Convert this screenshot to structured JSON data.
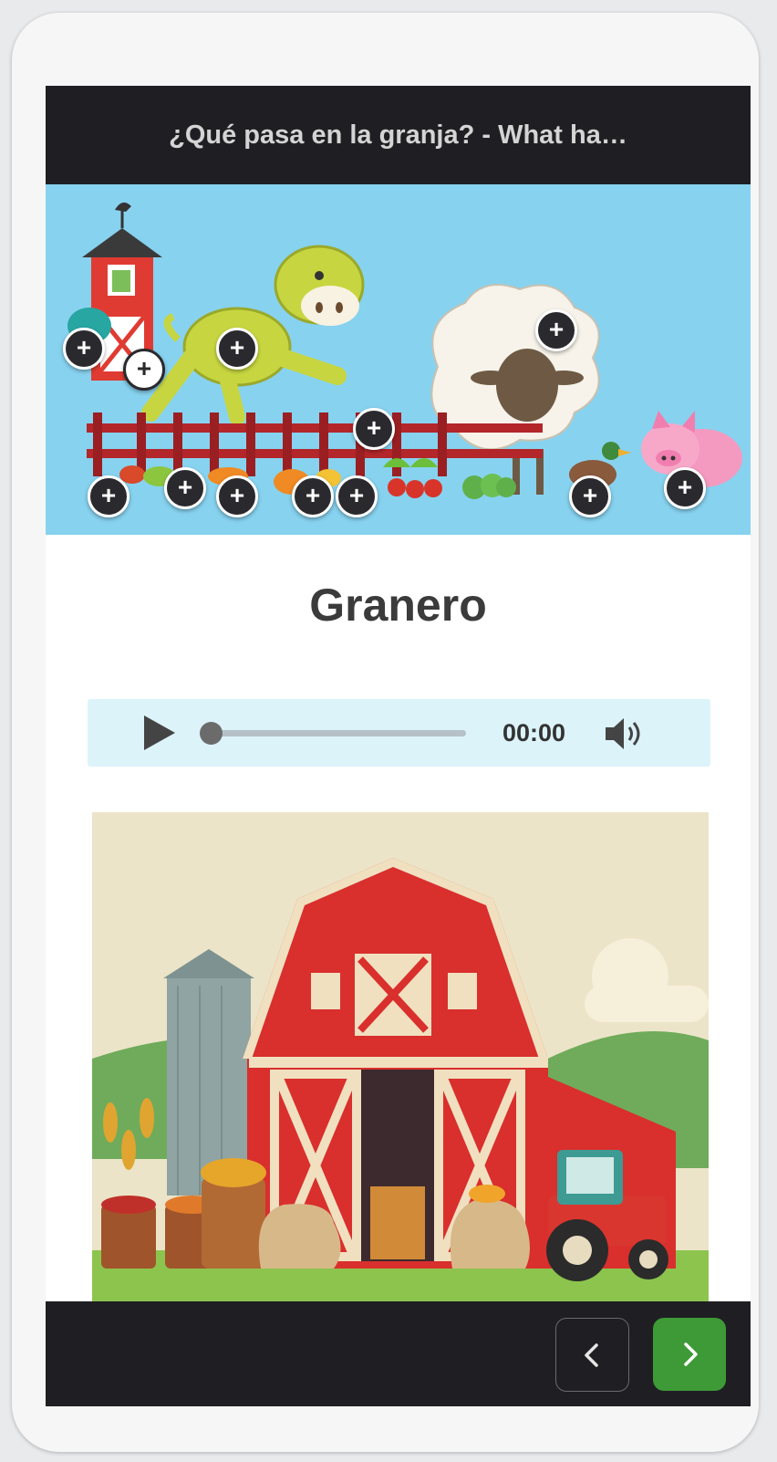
{
  "header": {
    "title": "¿Qué pasa en la granja? - What ha…"
  },
  "scene": {
    "hotspot_label": "+",
    "hotspots": [
      "+",
      "+",
      "+",
      "+",
      "+",
      "+",
      "+",
      "+",
      "+",
      "+",
      "+",
      "+",
      "+",
      "+"
    ]
  },
  "page": {
    "title": "Granero"
  },
  "audio": {
    "time": "00:00",
    "progress": 0
  },
  "picture": {
    "subject": "red barn with silo, tractor and grain sacks"
  },
  "nav": {
    "prev": "chevron-left-icon",
    "next": "chevron-right-icon"
  },
  "colors": {
    "header_bg": "#1f1f23",
    "scene_bg": "#87d2ef",
    "audio_bg": "#dcf3fa",
    "next_button": "#3e9a36",
    "title_text": "#3b3b3b"
  }
}
